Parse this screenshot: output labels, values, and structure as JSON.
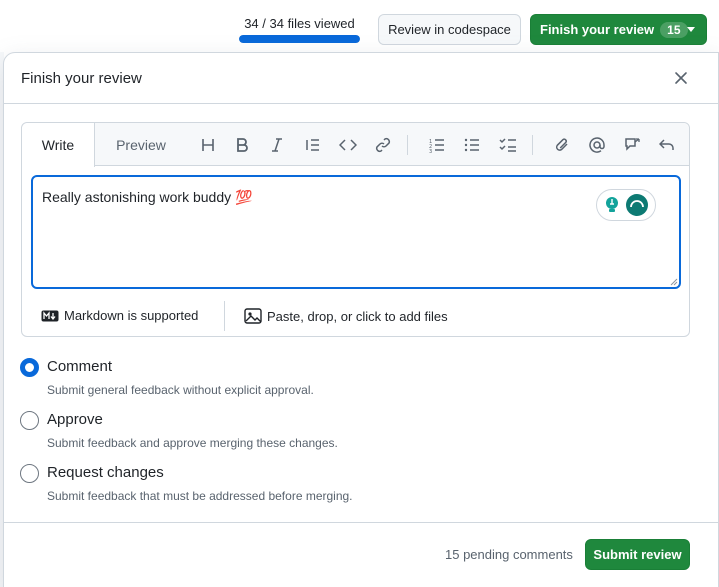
{
  "topbar": {
    "files_viewed": "34 / 34 files viewed",
    "progress_fraction": 1.0,
    "codespace_label": "Review in codespace",
    "finish_label": "Finish your review",
    "finish_count": "15"
  },
  "dialog": {
    "title": "Finish your review",
    "close_icon": "x-icon"
  },
  "editor": {
    "tabs": [
      "Write",
      "Preview"
    ],
    "active_tab": "Write",
    "toolbar_icons": [
      "heading-icon",
      "bold-icon",
      "italic-icon",
      "quote-icon",
      "code-icon",
      "link-icon",
      "numbered-list-icon",
      "bullet-list-icon",
      "task-list-icon",
      "attach-icon",
      "mention-icon",
      "reference-icon",
      "undo-icon"
    ],
    "text": "Really astonishing work buddy 💯",
    "markdown_note": "Markdown is supported",
    "attach_note": "Paste, drop, or click to add files"
  },
  "options": [
    {
      "label": "Comment",
      "desc": "Submit general feedback without explicit approval.",
      "checked": true
    },
    {
      "label": "Approve",
      "desc": "Submit feedback and approve merging these changes.",
      "checked": false
    },
    {
      "label": "Request changes",
      "desc": "Submit feedback that must be addressed before merging.",
      "checked": false
    }
  ],
  "footer": {
    "pending": "15 pending comments",
    "submit_label": "Submit review"
  },
  "colors": {
    "accent": "#0969da",
    "primary_button": "#1f883d",
    "border": "#d0d7de",
    "muted_text": "#59636e"
  }
}
